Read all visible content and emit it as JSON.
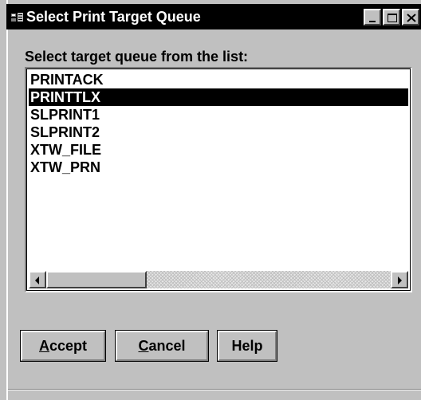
{
  "window": {
    "title": "Select Print Target Queue"
  },
  "prompt": "Select target queue from the list:",
  "queues": [
    "PRINTACK",
    "PRINTTLX",
    "SLPRINT1",
    "SLPRINT2",
    "XTW_FILE",
    "XTW_PRN"
  ],
  "selected_queue": "PRINTTLX",
  "buttons": {
    "accept": {
      "mnemonic": "A",
      "rest": "ccept"
    },
    "cancel": {
      "mnemonic": "C",
      "rest": "ancel"
    },
    "help": "Help"
  },
  "icons": {
    "title": "window-menu-icon",
    "minimize": "minimize-icon",
    "maximize": "maximize-icon",
    "close": "close-icon",
    "scroll_left": "arrow-left-icon",
    "scroll_right": "arrow-right-icon"
  },
  "colors": {
    "face": "#c0c0c0",
    "titlebar": "#000000",
    "selection": "#000000",
    "selection_text": "#ffffff"
  }
}
